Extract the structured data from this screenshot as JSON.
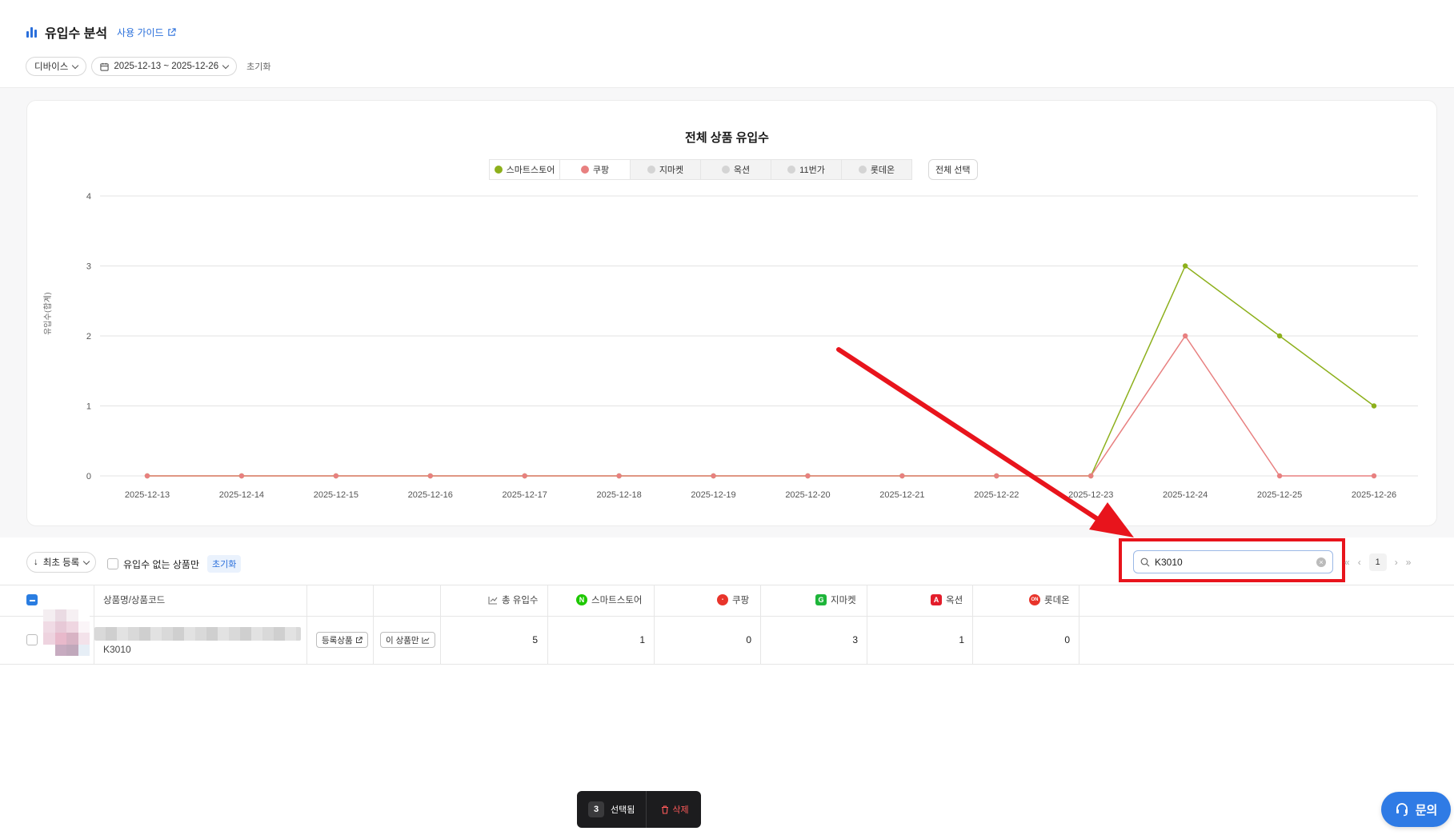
{
  "header": {
    "title": "유입수 분석",
    "guide_label": "사용 가이드",
    "device_filter": "디바이스",
    "date_range": "2025-12-13 ~ 2025-12-26",
    "reset_label": "초기화"
  },
  "chart": {
    "title": "전체 상품 유입수",
    "legend": [
      {
        "label": "스마트스토어",
        "color": "#8db01c",
        "active": true
      },
      {
        "label": "쿠팡",
        "color": "#e88080",
        "active": true
      },
      {
        "label": "지마켓",
        "color": "#d4d4d4",
        "active": false
      },
      {
        "label": "옥션",
        "color": "#d4d4d4",
        "active": false
      },
      {
        "label": "11번가",
        "color": "#d4d4d4",
        "active": false
      },
      {
        "label": "롯데온",
        "color": "#d4d4d4",
        "active": false
      }
    ],
    "select_all_label": "전체 선택",
    "ylabel": "유입수(합계)"
  },
  "chart_data": {
    "type": "line",
    "title": "전체 상품 유입수",
    "ylabel": "유입수(합계)",
    "xlabel": "",
    "x": [
      "2025-12-13",
      "2025-12-14",
      "2025-12-15",
      "2025-12-16",
      "2025-12-17",
      "2025-12-18",
      "2025-12-19",
      "2025-12-20",
      "2025-12-21",
      "2025-12-22",
      "2025-12-23",
      "2025-12-24",
      "2025-12-25",
      "2025-12-26"
    ],
    "ylim": [
      0,
      4
    ],
    "yticks": [
      0,
      1,
      2,
      3,
      4
    ],
    "grid": true,
    "series": [
      {
        "name": "스마트스토어",
        "color": "#8db01c",
        "values": [
          0,
          0,
          0,
          0,
          0,
          0,
          0,
          0,
          0,
          0,
          0,
          3,
          2,
          1
        ]
      },
      {
        "name": "쿠팡",
        "color": "#e88080",
        "values": [
          0,
          0,
          0,
          0,
          0,
          0,
          0,
          0,
          0,
          0,
          0,
          2,
          0,
          0
        ]
      }
    ]
  },
  "toolbar": {
    "sort_label": "최초 등록",
    "no_inflow_label": "유입수 없는 상품만",
    "reset_label": "초기화",
    "search_value": "K3010",
    "page": "1"
  },
  "table": {
    "headers": {
      "product": "상품명/상품코드",
      "total": "총 유입수",
      "smartstore": "스마트스토어",
      "coupang": "쿠팡",
      "gmarket": "지마켓",
      "auction": "옥션",
      "lotteon": "롯데온"
    },
    "rows": [
      {
        "code": "K3010",
        "registered_btn": "등록상품",
        "only_btn": "이 상품만",
        "total": "5",
        "smartstore": "1",
        "coupang": "0",
        "gmarket": "3",
        "auction": "1",
        "lotteon": "0"
      }
    ]
  },
  "action_bar": {
    "count": "3",
    "selected_label": "선택됨",
    "delete_label": "삭제"
  },
  "inquiry_label": "문의"
}
